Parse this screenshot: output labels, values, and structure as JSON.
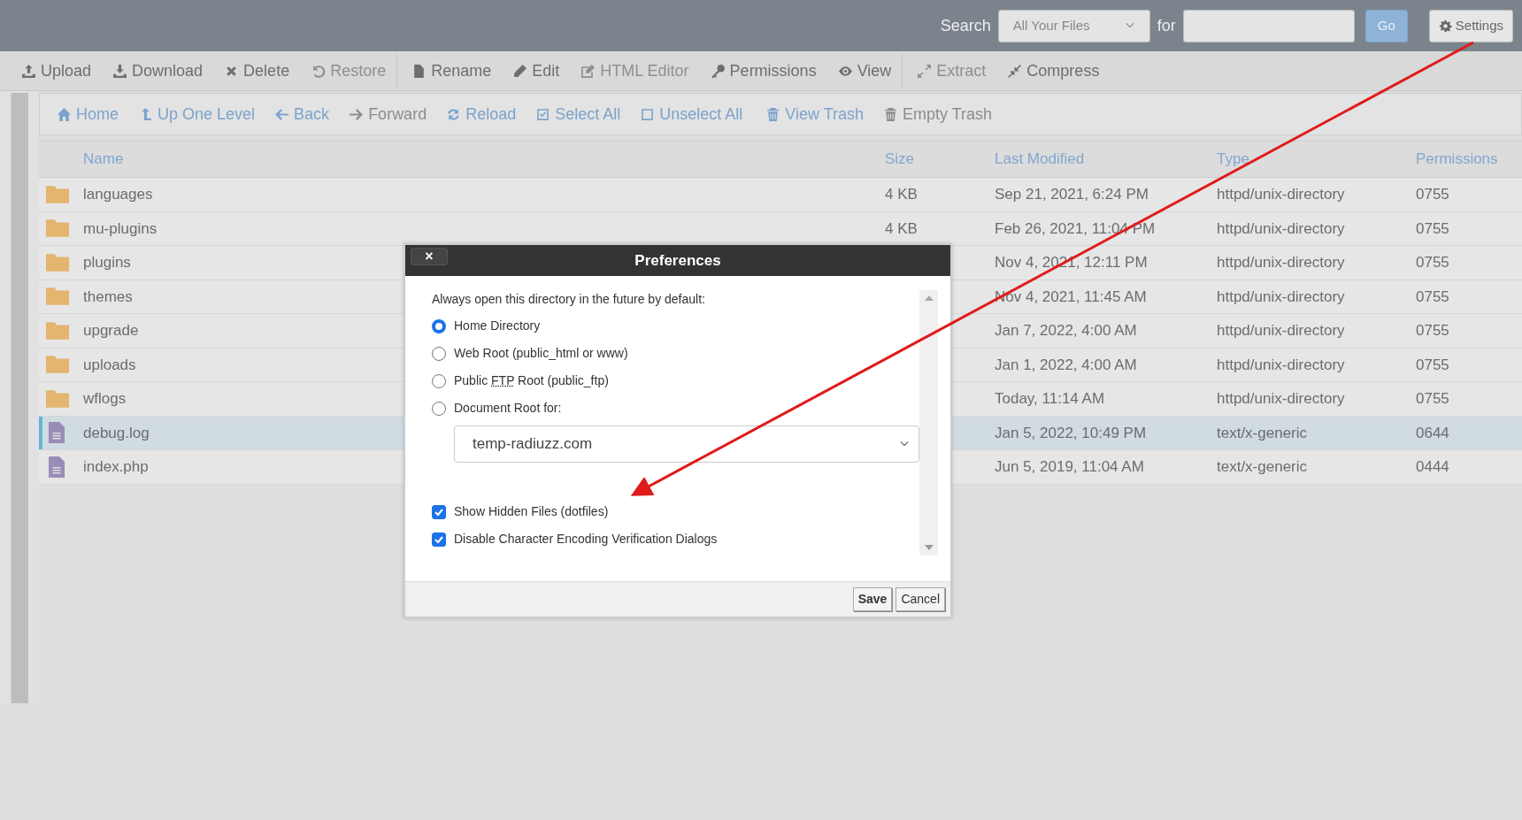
{
  "top_bar": {
    "search_label": "Search",
    "scope": "All Your Files",
    "for_label": "for",
    "go": "Go",
    "settings": "Settings"
  },
  "toolbar": [
    {
      "label": "Upload",
      "disabled": false,
      "group_end": false
    },
    {
      "label": "Download",
      "disabled": false,
      "group_end": false
    },
    {
      "label": "Delete",
      "disabled": false,
      "group_end": false
    },
    {
      "label": "Restore",
      "disabled": true,
      "group_end": true
    },
    {
      "label": "Rename",
      "disabled": false,
      "group_end": false
    },
    {
      "label": "Edit",
      "disabled": false,
      "group_end": false
    },
    {
      "label": "HTML Editor",
      "disabled": true,
      "group_end": false
    },
    {
      "label": "Permissions",
      "disabled": false,
      "group_end": false
    },
    {
      "label": "View",
      "disabled": false,
      "group_end": true
    },
    {
      "label": "Extract",
      "disabled": true,
      "group_end": false
    },
    {
      "label": "Compress",
      "disabled": false,
      "group_end": false
    }
  ],
  "nav": [
    {
      "label": "Home",
      "disabled": false,
      "group_end": false
    },
    {
      "label": "Up One Level",
      "disabled": false,
      "group_end": false
    },
    {
      "label": "Back",
      "disabled": false,
      "group_end": false
    },
    {
      "label": "Forward",
      "disabled": true,
      "group_end": false
    },
    {
      "label": "Reload",
      "disabled": false,
      "group_end": false
    },
    {
      "label": "Select All",
      "disabled": false,
      "group_end": false
    },
    {
      "label": "Unselect All",
      "disabled": false,
      "group_end": true
    },
    {
      "label": "View Trash",
      "disabled": false,
      "group_end": false
    },
    {
      "label": "Empty Trash",
      "disabled": true,
      "group_end": false
    }
  ],
  "table": {
    "columns": [
      "Name",
      "Size",
      "Last Modified",
      "Type",
      "Permissions"
    ],
    "rows": [
      {
        "kind": "folder",
        "name": "languages",
        "size": "4 KB",
        "modified": "Sep 21, 2021, 6:24 PM",
        "type": "httpd/unix-directory",
        "permissions": "0755",
        "selected": false
      },
      {
        "kind": "folder",
        "name": "mu-plugins",
        "size": "4 KB",
        "modified": "Feb 26, 2021, 11:04 PM",
        "type": "httpd/unix-directory",
        "permissions": "0755",
        "selected": false
      },
      {
        "kind": "folder",
        "name": "plugins",
        "modified": "Nov 4, 2021, 12:11 PM",
        "type": "httpd/unix-directory",
        "permissions": "0755",
        "selected": false
      },
      {
        "kind": "folder",
        "name": "themes",
        "modified": "Nov 4, 2021, 11:45 AM",
        "type": "httpd/unix-directory",
        "permissions": "0755",
        "selected": false
      },
      {
        "kind": "folder",
        "name": "upgrade",
        "modified": "Jan 7, 2022, 4:00 AM",
        "type": "httpd/unix-directory",
        "permissions": "0755",
        "selected": false
      },
      {
        "kind": "folder",
        "name": "uploads",
        "modified": "Jan 1, 2022, 4:00 AM",
        "type": "httpd/unix-directory",
        "permissions": "0755",
        "selected": false
      },
      {
        "kind": "folder",
        "name": "wflogs",
        "modified": "Today, 11:14 AM",
        "type": "httpd/unix-directory",
        "permissions": "0755",
        "selected": false
      },
      {
        "kind": "file",
        "name": "debug.log",
        "modified": "Jan 5, 2022, 10:49 PM",
        "type": "text/x-generic",
        "permissions": "0644",
        "selected": true
      },
      {
        "kind": "file",
        "name": "index.php",
        "modified": "Jun 5, 2019, 11:04 AM",
        "type": "text/x-generic",
        "permissions": "0444",
        "selected": false
      }
    ]
  },
  "dialog": {
    "title": "Preferences",
    "close": "×",
    "prompt": "Always open this directory in the future by default:",
    "options": [
      {
        "label": "Home Directory",
        "selected": true
      },
      {
        "label": "Web Root (public_html or www)",
        "selected": false
      },
      {
        "label": "Public **FTP** Root (public_ftp)",
        "selected": false
      },
      {
        "label": "Document Root for:",
        "selected": false
      }
    ],
    "domain": "temp-radiuzz.com",
    "checkboxes": [
      {
        "label": "Show Hidden Files (dotfiles)",
        "checked": true
      },
      {
        "label": "Disable Character Encoding Verification Dialogs",
        "checked": true
      }
    ],
    "buttons": [
      "Save",
      "Cancel"
    ]
  }
}
